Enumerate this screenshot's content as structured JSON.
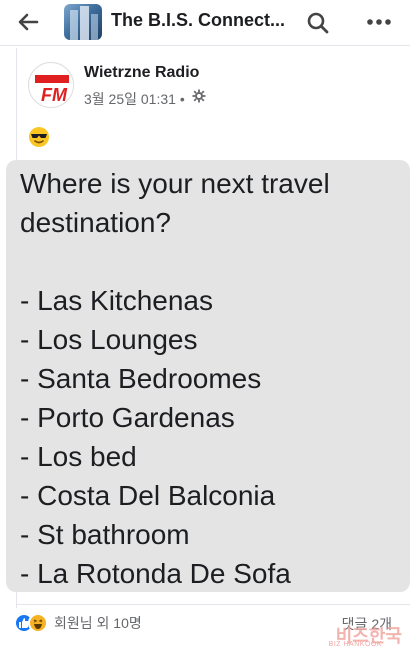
{
  "header": {
    "title": "The B.I.S. Connect...",
    "back_icon": "back-arrow-icon",
    "search_icon": "search-icon",
    "more_icon": "more-dots-icon"
  },
  "post": {
    "author": "Wietrzne Radio",
    "avatar_logo": "FM",
    "timestamp": "3월 25일 01:31 •",
    "privacy_icon": "gear-icon",
    "emoji": "😎",
    "lines": [
      "Where is your next travel",
      "destination?",
      "",
      "- Las Kitchenas",
      "- Los Lounges",
      "- Santa Bedroomes",
      "- Porto Gardenas",
      "- Los bed",
      "- Costa Del Balconia",
      "- St bathroom",
      "- La Rotonda De Sofa"
    ],
    "background_color": "#e4e4e4"
  },
  "footer": {
    "reactions_text": "회원님 외 10명",
    "comments_text": "댓글 2개"
  },
  "watermark": {
    "text": "비즈한국",
    "sub": "BIZ HANKOOK"
  },
  "colors": {
    "accent": "#1877f2",
    "secondary_text": "#65676b"
  }
}
